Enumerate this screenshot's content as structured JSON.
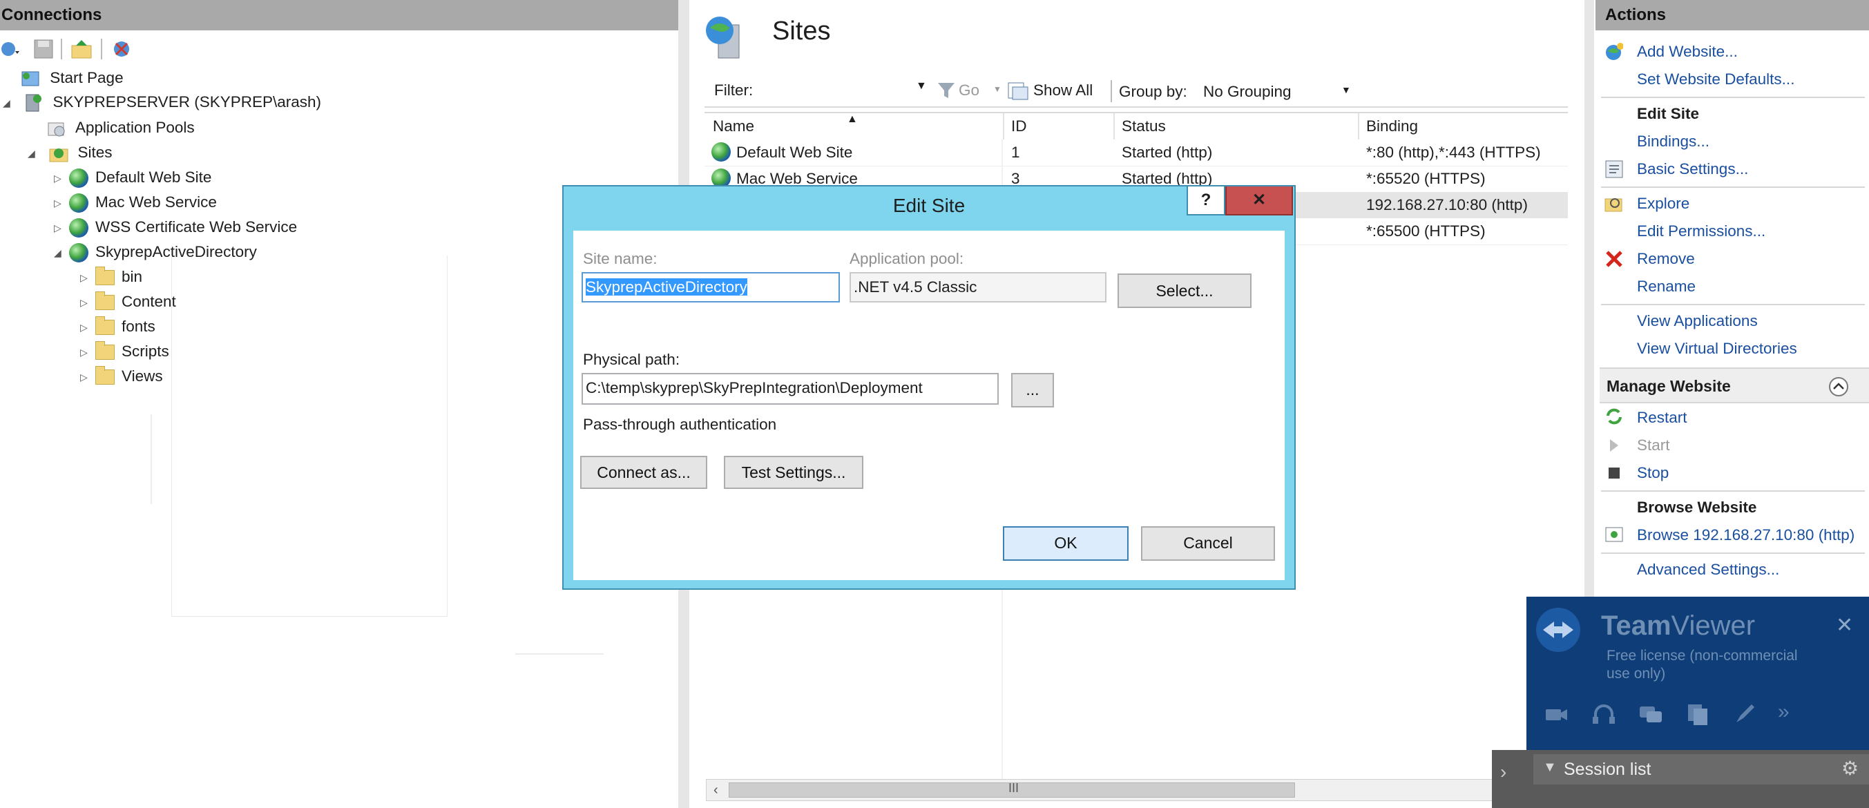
{
  "connections": {
    "title": "Connections",
    "tree": {
      "start_page": "Start Page",
      "server": "SKYPREPSERVER (SKYPREP\\arash)",
      "app_pools": "Application Pools",
      "sites": "Sites",
      "site_items": [
        "Default Web Site",
        "Mac Web Service",
        "WSS Certificate Web Service",
        "SkyprepActiveDirectory"
      ],
      "folders": [
        "bin",
        "Content",
        "fonts",
        "Scripts",
        "Views"
      ]
    }
  },
  "sites_panel": {
    "title": "Sites",
    "filter_label": "Filter:",
    "go_label": "Go",
    "show_all_label": "Show All",
    "group_by_label": "Group by:",
    "group_by_value": "No Grouping",
    "columns": [
      "Name",
      "ID",
      "Status",
      "Binding"
    ],
    "rows": [
      {
        "name": "Default Web Site",
        "id": "1",
        "status": "Started (http)",
        "binding": "*:80 (http),*:443 (HTTPS)"
      },
      {
        "name": "Mac Web Service",
        "id": "3",
        "status": "Started (http)",
        "binding": "*:65520 (HTTPS)"
      },
      {
        "name": "",
        "id": "",
        "status": "",
        "binding": "192.168.27.10:80 (http)"
      },
      {
        "name": "",
        "id": "",
        "status": "",
        "binding": "*:65500 (HTTPS)"
      }
    ],
    "scrollbar_grip": "III"
  },
  "actions": {
    "title": "Actions",
    "add_website": "Add Website...",
    "set_defaults": "Set Website Defaults...",
    "edit_site_heading": "Edit Site",
    "bindings": "Bindings...",
    "basic_settings": "Basic Settings...",
    "explore": "Explore",
    "edit_permissions": "Edit Permissions...",
    "remove": "Remove",
    "rename": "Rename",
    "view_applications": "View Applications",
    "view_virtual_dirs": "View Virtual Directories",
    "manage_website": "Manage Website",
    "restart": "Restart",
    "start": "Start",
    "stop": "Stop",
    "browse_website_heading": "Browse Website",
    "browse_link": "Browse 192.168.27.10:80 (http)",
    "advanced_settings": "Advanced Settings..."
  },
  "dialog": {
    "title": "Edit Site",
    "help_label": "?",
    "close_label": "✕",
    "site_name_label": "Site name:",
    "site_name_value": "SkyprepActiveDirectory",
    "app_pool_label": "Application pool:",
    "app_pool_value": ".NET v4.5 Classic",
    "select_button": "Select...",
    "physical_path_label": "Physical path:",
    "physical_path_value": "C:\\temp\\skyprep\\SkyPrepIntegration\\Deployment",
    "browse_button": "...",
    "passthrough_label": "Pass-through authentication",
    "connect_as_button": "Connect as...",
    "test_settings_button": "Test Settings...",
    "ok_button": "OK",
    "cancel_button": "Cancel"
  },
  "teamviewer": {
    "brand_bold": "Team",
    "brand_light": "Viewer",
    "license_line1": "Free license (non-commercial",
    "license_line2": "use only)",
    "close_label": "✕",
    "session_list": "Session list"
  }
}
